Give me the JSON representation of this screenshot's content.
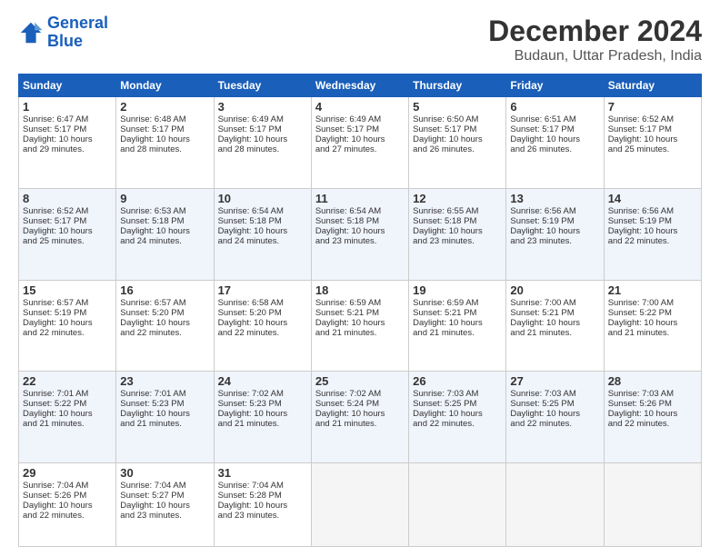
{
  "logo": {
    "line1": "General",
    "line2": "Blue"
  },
  "title": "December 2024",
  "subtitle": "Budaun, Uttar Pradesh, India",
  "days_of_week": [
    "Sunday",
    "Monday",
    "Tuesday",
    "Wednesday",
    "Thursday",
    "Friday",
    "Saturday"
  ],
  "weeks": [
    [
      {
        "day": "1",
        "info": "Sunrise: 6:47 AM\nSunset: 5:17 PM\nDaylight: 10 hours\nand 29 minutes."
      },
      {
        "day": "2",
        "info": "Sunrise: 6:48 AM\nSunset: 5:17 PM\nDaylight: 10 hours\nand 28 minutes."
      },
      {
        "day": "3",
        "info": "Sunrise: 6:49 AM\nSunset: 5:17 PM\nDaylight: 10 hours\nand 28 minutes."
      },
      {
        "day": "4",
        "info": "Sunrise: 6:49 AM\nSunset: 5:17 PM\nDaylight: 10 hours\nand 27 minutes."
      },
      {
        "day": "5",
        "info": "Sunrise: 6:50 AM\nSunset: 5:17 PM\nDaylight: 10 hours\nand 26 minutes."
      },
      {
        "day": "6",
        "info": "Sunrise: 6:51 AM\nSunset: 5:17 PM\nDaylight: 10 hours\nand 26 minutes."
      },
      {
        "day": "7",
        "info": "Sunrise: 6:52 AM\nSunset: 5:17 PM\nDaylight: 10 hours\nand 25 minutes."
      }
    ],
    [
      {
        "day": "8",
        "info": "Sunrise: 6:52 AM\nSunset: 5:17 PM\nDaylight: 10 hours\nand 25 minutes."
      },
      {
        "day": "9",
        "info": "Sunrise: 6:53 AM\nSunset: 5:18 PM\nDaylight: 10 hours\nand 24 minutes."
      },
      {
        "day": "10",
        "info": "Sunrise: 6:54 AM\nSunset: 5:18 PM\nDaylight: 10 hours\nand 24 minutes."
      },
      {
        "day": "11",
        "info": "Sunrise: 6:54 AM\nSunset: 5:18 PM\nDaylight: 10 hours\nand 23 minutes."
      },
      {
        "day": "12",
        "info": "Sunrise: 6:55 AM\nSunset: 5:18 PM\nDaylight: 10 hours\nand 23 minutes."
      },
      {
        "day": "13",
        "info": "Sunrise: 6:56 AM\nSunset: 5:19 PM\nDaylight: 10 hours\nand 23 minutes."
      },
      {
        "day": "14",
        "info": "Sunrise: 6:56 AM\nSunset: 5:19 PM\nDaylight: 10 hours\nand 22 minutes."
      }
    ],
    [
      {
        "day": "15",
        "info": "Sunrise: 6:57 AM\nSunset: 5:19 PM\nDaylight: 10 hours\nand 22 minutes."
      },
      {
        "day": "16",
        "info": "Sunrise: 6:57 AM\nSunset: 5:20 PM\nDaylight: 10 hours\nand 22 minutes."
      },
      {
        "day": "17",
        "info": "Sunrise: 6:58 AM\nSunset: 5:20 PM\nDaylight: 10 hours\nand 22 minutes."
      },
      {
        "day": "18",
        "info": "Sunrise: 6:59 AM\nSunset: 5:21 PM\nDaylight: 10 hours\nand 21 minutes."
      },
      {
        "day": "19",
        "info": "Sunrise: 6:59 AM\nSunset: 5:21 PM\nDaylight: 10 hours\nand 21 minutes."
      },
      {
        "day": "20",
        "info": "Sunrise: 7:00 AM\nSunset: 5:21 PM\nDaylight: 10 hours\nand 21 minutes."
      },
      {
        "day": "21",
        "info": "Sunrise: 7:00 AM\nSunset: 5:22 PM\nDaylight: 10 hours\nand 21 minutes."
      }
    ],
    [
      {
        "day": "22",
        "info": "Sunrise: 7:01 AM\nSunset: 5:22 PM\nDaylight: 10 hours\nand 21 minutes."
      },
      {
        "day": "23",
        "info": "Sunrise: 7:01 AM\nSunset: 5:23 PM\nDaylight: 10 hours\nand 21 minutes."
      },
      {
        "day": "24",
        "info": "Sunrise: 7:02 AM\nSunset: 5:23 PM\nDaylight: 10 hours\nand 21 minutes."
      },
      {
        "day": "25",
        "info": "Sunrise: 7:02 AM\nSunset: 5:24 PM\nDaylight: 10 hours\nand 21 minutes."
      },
      {
        "day": "26",
        "info": "Sunrise: 7:03 AM\nSunset: 5:25 PM\nDaylight: 10 hours\nand 22 minutes."
      },
      {
        "day": "27",
        "info": "Sunrise: 7:03 AM\nSunset: 5:25 PM\nDaylight: 10 hours\nand 22 minutes."
      },
      {
        "day": "28",
        "info": "Sunrise: 7:03 AM\nSunset: 5:26 PM\nDaylight: 10 hours\nand 22 minutes."
      }
    ],
    [
      {
        "day": "29",
        "info": "Sunrise: 7:04 AM\nSunset: 5:26 PM\nDaylight: 10 hours\nand 22 minutes."
      },
      {
        "day": "30",
        "info": "Sunrise: 7:04 AM\nSunset: 5:27 PM\nDaylight: 10 hours\nand 23 minutes."
      },
      {
        "day": "31",
        "info": "Sunrise: 7:04 AM\nSunset: 5:28 PM\nDaylight: 10 hours\nand 23 minutes."
      },
      {
        "day": "",
        "info": ""
      },
      {
        "day": "",
        "info": ""
      },
      {
        "day": "",
        "info": ""
      },
      {
        "day": "",
        "info": ""
      }
    ]
  ]
}
